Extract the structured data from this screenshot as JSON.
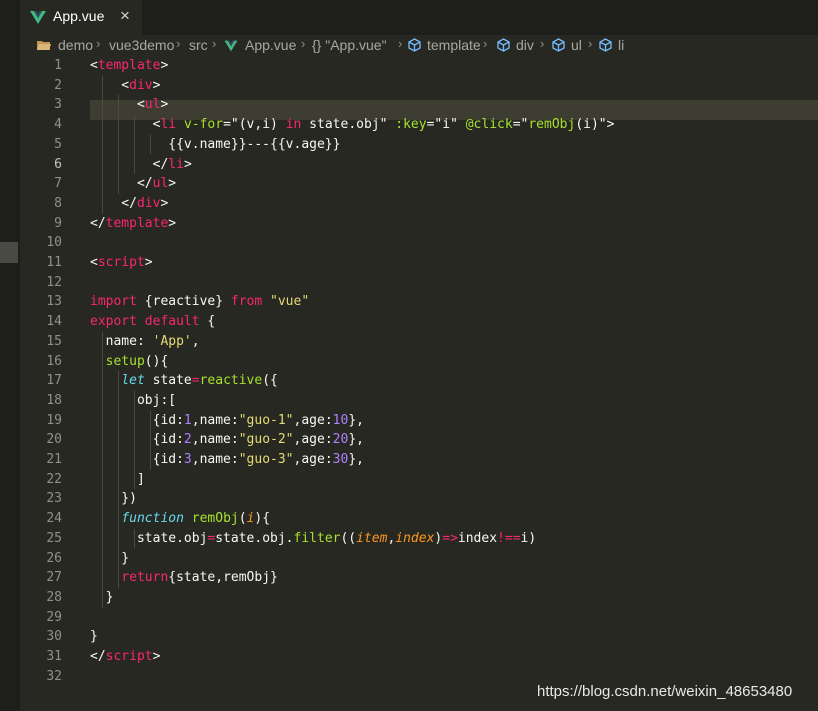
{
  "tab": {
    "label": "App.vue",
    "close": "×",
    "accent": "#41b883"
  },
  "breadcrumb": [
    "demo",
    "vue3demo",
    "src",
    "App.vue",
    "{} \"App.vue\"",
    "template",
    "div",
    "ul",
    "li"
  ],
  "active_line": 6,
  "lines": [
    {
      "n": "1",
      "segs": [
        [
          "w",
          "<"
        ],
        [
          "t",
          "template"
        ],
        [
          "w",
          ">"
        ]
      ]
    },
    {
      "n": "2",
      "segs": [
        [
          "w",
          "    <"
        ],
        [
          "t",
          "div"
        ],
        [
          "w",
          ">"
        ]
      ]
    },
    {
      "n": "3",
      "segs": [
        [
          "w",
          "      <"
        ],
        [
          "t",
          "ul"
        ],
        [
          "w",
          ">"
        ]
      ]
    },
    {
      "n": "4",
      "segs": [
        [
          "w",
          "        <"
        ],
        [
          "t",
          "li"
        ],
        [
          "w",
          " "
        ],
        [
          "a",
          "v-for"
        ],
        [
          "w",
          "=\"(v,i) "
        ],
        [
          "t",
          "in"
        ],
        [
          "w",
          " state.obj\" "
        ],
        [
          "a",
          ":key"
        ],
        [
          "w",
          "=\"i\" "
        ],
        [
          "a",
          "@click"
        ],
        [
          "w",
          "=\""
        ],
        [
          "a",
          "remObj"
        ],
        [
          "w",
          "(i)\">"
        ]
      ]
    },
    {
      "n": "5",
      "segs": [
        [
          "w",
          "          {{v.name}}---{{v.age}}"
        ]
      ]
    },
    {
      "n": "6",
      "segs": [
        [
          "w",
          "        </"
        ],
        [
          "t",
          "li"
        ],
        [
          "w",
          ">"
        ]
      ]
    },
    {
      "n": "7",
      "segs": [
        [
          "w",
          "      </"
        ],
        [
          "t",
          "ul"
        ],
        [
          "w",
          ">"
        ]
      ]
    },
    {
      "n": "8",
      "segs": [
        [
          "w",
          "    </"
        ],
        [
          "t",
          "div"
        ],
        [
          "w",
          ">"
        ]
      ]
    },
    {
      "n": "9",
      "segs": [
        [
          "w",
          "</"
        ],
        [
          "t",
          "template"
        ],
        [
          "w",
          ">"
        ]
      ]
    },
    {
      "n": "10",
      "segs": []
    },
    {
      "n": "11",
      "segs": [
        [
          "w",
          "<"
        ],
        [
          "t",
          "script"
        ],
        [
          "w",
          ">"
        ]
      ]
    },
    {
      "n": "12",
      "segs": []
    },
    {
      "n": "13",
      "segs": [
        [
          "t",
          "import"
        ],
        [
          "w",
          " {reactive} "
        ],
        [
          "t",
          "from"
        ],
        [
          "w",
          " "
        ],
        [
          "s",
          "\"vue\""
        ]
      ]
    },
    {
      "n": "14",
      "segs": [
        [
          "t",
          "export"
        ],
        [
          "w",
          " "
        ],
        [
          "t",
          "default"
        ],
        [
          "w",
          " {"
        ]
      ]
    },
    {
      "n": "15",
      "segs": [
        [
          "w",
          "  name: "
        ],
        [
          "s",
          "'App'"
        ],
        [
          "w",
          ","
        ]
      ]
    },
    {
      "n": "16",
      "segs": [
        [
          "w",
          "  "
        ],
        [
          "f",
          "setup"
        ],
        [
          "w",
          "(){"
        ]
      ]
    },
    {
      "n": "17",
      "segs": [
        [
          "w",
          "    "
        ],
        [
          "k",
          "let"
        ],
        [
          "w",
          " state"
        ],
        [
          "t",
          "="
        ],
        [
          "f",
          "reactive"
        ],
        [
          "w",
          "({"
        ]
      ]
    },
    {
      "n": "18",
      "segs": [
        [
          "w",
          "      obj:["
        ]
      ]
    },
    {
      "n": "19",
      "segs": [
        [
          "w",
          "        {id:"
        ],
        [
          "n",
          "1"
        ],
        [
          "w",
          ",name:"
        ],
        [
          "s",
          "\"guo-1\""
        ],
        [
          "w",
          ",age:"
        ],
        [
          "n",
          "10"
        ],
        [
          "w",
          "},"
        ]
      ]
    },
    {
      "n": "20",
      "segs": [
        [
          "w",
          "        {id:"
        ],
        [
          "n",
          "2"
        ],
        [
          "w",
          ",name:"
        ],
        [
          "s",
          "\"guo-2\""
        ],
        [
          "w",
          ",age:"
        ],
        [
          "n",
          "20"
        ],
        [
          "w",
          "},"
        ]
      ]
    },
    {
      "n": "21",
      "segs": [
        [
          "w",
          "        {id:"
        ],
        [
          "n",
          "3"
        ],
        [
          "w",
          ",name:"
        ],
        [
          "s",
          "\"guo-3\""
        ],
        [
          "w",
          ",age:"
        ],
        [
          "n",
          "30"
        ],
        [
          "w",
          "},"
        ]
      ]
    },
    {
      "n": "22",
      "segs": [
        [
          "w",
          "      ]"
        ]
      ]
    },
    {
      "n": "23",
      "segs": [
        [
          "w",
          "    })"
        ]
      ]
    },
    {
      "n": "24",
      "segs": [
        [
          "w",
          "    "
        ],
        [
          "k",
          "function"
        ],
        [
          "w",
          " "
        ],
        [
          "f",
          "remObj"
        ],
        [
          "w",
          "("
        ],
        [
          "p",
          "i"
        ],
        [
          "w",
          "){"
        ]
      ]
    },
    {
      "n": "25",
      "segs": [
        [
          "w",
          "      state.obj"
        ],
        [
          "t",
          "="
        ],
        [
          "w",
          "state.obj."
        ],
        [
          "f",
          "filter"
        ],
        [
          "w",
          "(("
        ],
        [
          "p",
          "item"
        ],
        [
          "w",
          ","
        ],
        [
          "p",
          "index"
        ],
        [
          "w",
          ")"
        ],
        [
          "t",
          "=>"
        ],
        [
          "w",
          "index"
        ],
        [
          "t",
          "!=="
        ],
        [
          "w",
          "i)"
        ]
      ]
    },
    {
      "n": "26",
      "segs": [
        [
          "w",
          "    }"
        ]
      ]
    },
    {
      "n": "27",
      "segs": [
        [
          "w",
          "    "
        ],
        [
          "t",
          "return"
        ],
        [
          "w",
          "{state,remObj}"
        ]
      ]
    },
    {
      "n": "28",
      "segs": [
        [
          "w",
          "  }"
        ]
      ]
    },
    {
      "n": "29",
      "segs": []
    },
    {
      "n": "30",
      "segs": [
        [
          "w",
          "}"
        ]
      ]
    },
    {
      "n": "31",
      "segs": [
        [
          "w",
          "</"
        ],
        [
          "t",
          "script"
        ],
        [
          "w",
          ">"
        ]
      ]
    },
    {
      "n": "32",
      "segs": []
    }
  ],
  "watermark": "https://blog.csdn.net/weixin_48653480"
}
